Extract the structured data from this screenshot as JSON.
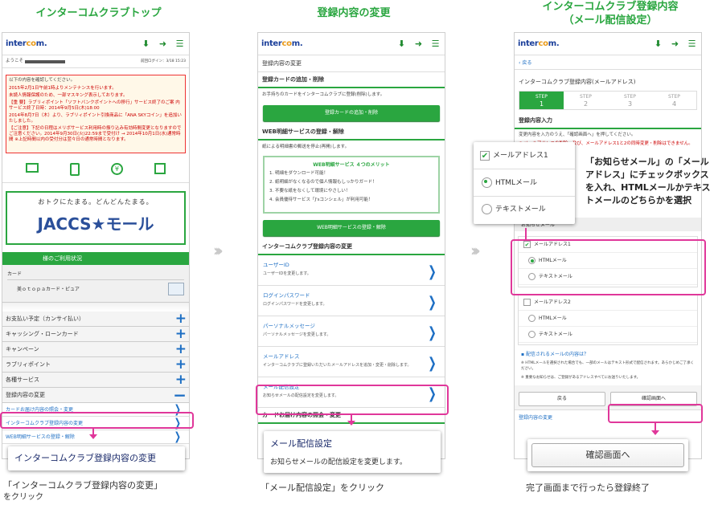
{
  "titles": {
    "col1": "インターコムクラブトップ",
    "col2": "登録内容の変更",
    "col3_line1": "インターコムクラブ登録内容",
    "col3_line2": "（メール配信設定）"
  },
  "logo": {
    "main": "inter",
    "accent": "co",
    "tail": "m."
  },
  "phone1": {
    "welcome": "ようこそ",
    "last_login": "前回ログイン：3/18 15:23",
    "notice_title": "以下の内容を確認してください。",
    "notices": [
      "2015年2月1日午前1時よりメンテナンスを行います。",
      "未読人情報保護のため、一部マスキング表示しております。",
      "【重 要】ラブリィポイント「ソフトバンクポイントへの移行」サービス終了のご案 内 サービス終了日時：2014年9月5日(木)18:00",
      "2014年8月7日（木）より、ラブリィポイント引換商品に「ANA SKYコイン」を追加いたしました。",
      "【ご注意】下記の日程はメリボサービス利用時の振り込み有効時間変更となりますのでご注意ください。2014年9月30日(火)22:59まで受付け → 2014年10月1日(水)通常時間 ※上記時間以内の受付分は翌々日の通常時間となります。"
    ],
    "banner_tagline": "おトクにたまる。どんどんたまる。",
    "banner_name": "JACCS★モール",
    "usage_bar": "様のご利用状況",
    "card_label": "カード",
    "card_name": "美ｏｔｏｐａカード・ピュア",
    "menu": [
      "お支払い予定（カンサイ払い）",
      "キャッシング・ローンカード",
      "キャンペーン",
      "ラブリィポイント",
      "各種サービス",
      "登録内容の変更"
    ],
    "submenu": [
      "カードお届け内容の照会・変更",
      "インターコムクラブ登録内容の変更",
      "WEB明細サービスの登録・解除"
    ],
    "callout": "インターコムクラブ登録内容の変更"
  },
  "phone2": {
    "heading": "登録内容の変更",
    "card_section": "登録カードの追加・削除",
    "card_desc": "お手持ちのカードをインターコムクラブに登録(削除)します。",
    "card_button": "登録カードの追加・削除",
    "web_section": "WEB明細サービスの登録・解除",
    "web_desc": "紙による明細書の郵送を停止(再開)します。",
    "merit_title": "WEB明細サービス ４つのメリット",
    "merits": [
      "1. 明細をダウンロード可能！",
      "2. 紙明細がなくなるので個人情報もしっかりガード！",
      "3. 不要な紙をなくして環境にやさしい！",
      "4. 会員優待サービス「J'sコンシェル」が利用可能！"
    ],
    "web_button": "WEB明細サービスの登録・解除",
    "club_section": "インターコムクラブ登録内容の変更",
    "items": [
      {
        "t": "ユーザーID",
        "d": "ユーザーIDを変更します。"
      },
      {
        "t": "ログインパスワード",
        "d": "ログインパスワードを変更します。"
      },
      {
        "t": "パーソナルメッセージ",
        "d": "パーソナルメッセージを変更します。"
      },
      {
        "t": "メールアドレス",
        "d": "インターコムクラブに登録いただいたメールアドレスを追加・変更・削除します。"
      },
      {
        "t": "メール配信設定",
        "d": "お知らせメールの配信設定を変更します。"
      }
    ],
    "bottom_section": "カードお届け内容の照会・変更",
    "popup_title": "メール配信設定",
    "popup_desc": "お知らせメールの配信設定を変更します。"
  },
  "phone3": {
    "back": "戻る",
    "heading": "インターコムクラブ登録内容(メールアドレス)",
    "steps": [
      {
        "s": "STEP",
        "n": "1"
      },
      {
        "s": "STEP",
        "n": "2"
      },
      {
        "s": "STEP",
        "n": "3"
      },
      {
        "s": "STEP",
        "n": "4"
      }
    ],
    "input_title": "登録内容入力",
    "desc1": "変更内容を入力のうえ、「確認画面へ」を押してください。",
    "desc2": "※ メールアドレスの削除、及び、メールアドレス1と2の同時変更・削除はできません。",
    "section": "お知らせメール",
    "addr1": "メールアドレス1",
    "addr2": "メールアドレス2",
    "html": "HTMLメール",
    "text": "テキストメール",
    "link": "配信されるメールの内容は？",
    "note1": "※ HTMLメールを選択された場合でも、一部のメールはテキスト形式で配信されます。あらかじめご了承ください。",
    "note2": "※ 重要なお知らせは、ご登録があるアドレスすべてにお送りいたします。",
    "back_btn": "戻る",
    "confirm_btn": "確認画面へ",
    "bottom_row": "登録内容の変更",
    "popup_addr": "メールアドレス1",
    "popup_html": "HTMLメール",
    "popup_text": "テキストメール",
    "confirm_big": "確認画面へ"
  },
  "annotations": {
    "note_a": "「お知らせメール」の「メールアドレス」にチェックボックスを入れ、HTMLメールかテキストメールのどちらかを選択",
    "cap1_line1": "「インターコムクラブ登録内容の変更」",
    "cap1_line2": "をクリック",
    "cap2": "「メール配信設定」をクリック",
    "cap3": "完了画面まで行ったら登録終了"
  },
  "colors": {
    "green": "#2aa640",
    "pink": "#e0379a",
    "blue": "#1e6fc4"
  }
}
